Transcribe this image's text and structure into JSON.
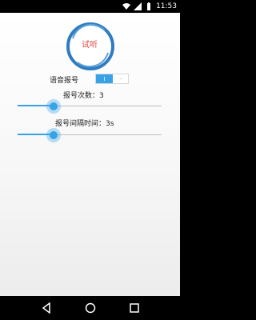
{
  "status_bar": {
    "time": "11:53",
    "icons": [
      "wifi-icon",
      "signal-icon",
      "battery-icon"
    ]
  },
  "listen_button": {
    "label": "试听"
  },
  "voice_announce": {
    "label": "语音报号",
    "toggle_on_text": "I",
    "toggle_off_text": "···",
    "enabled": true
  },
  "count_slider": {
    "label": "报号次数：3",
    "level": 0.25
  },
  "interval_slider": {
    "label": "报号间隔时间：3s",
    "level": 0.25
  },
  "nav_bar": {
    "icons": [
      "back-icon",
      "home-icon",
      "recents-icon"
    ]
  },
  "colors": {
    "accent": "#36a3e8",
    "listen_text": "#e04a3f",
    "ring": "#2f7cc0"
  }
}
